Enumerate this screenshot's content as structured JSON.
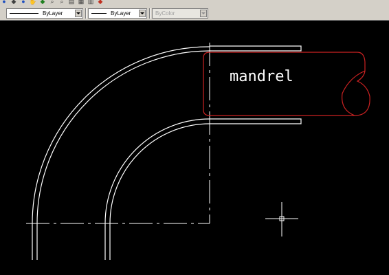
{
  "toolbar": {
    "icons": [
      "save-icon",
      "undo-icon",
      "redo-icon",
      "pan-icon",
      "zoom-realtime-icon",
      "zoom-window-icon",
      "zoom-previous-icon",
      "properties-icon",
      "design-center-icon",
      "tool-palettes-icon",
      "help-icon"
    ]
  },
  "properties": {
    "linetype": {
      "value": "ByLayer"
    },
    "lineweight": {
      "value": "ByLayer"
    },
    "plotstyle": {
      "value": "ByColor",
      "disabled": true
    }
  },
  "drawing": {
    "background": "#000000",
    "geometry_color": "#ffffff",
    "mandrel_color": "#cc2222",
    "mandrel_label": "mandrel"
  }
}
